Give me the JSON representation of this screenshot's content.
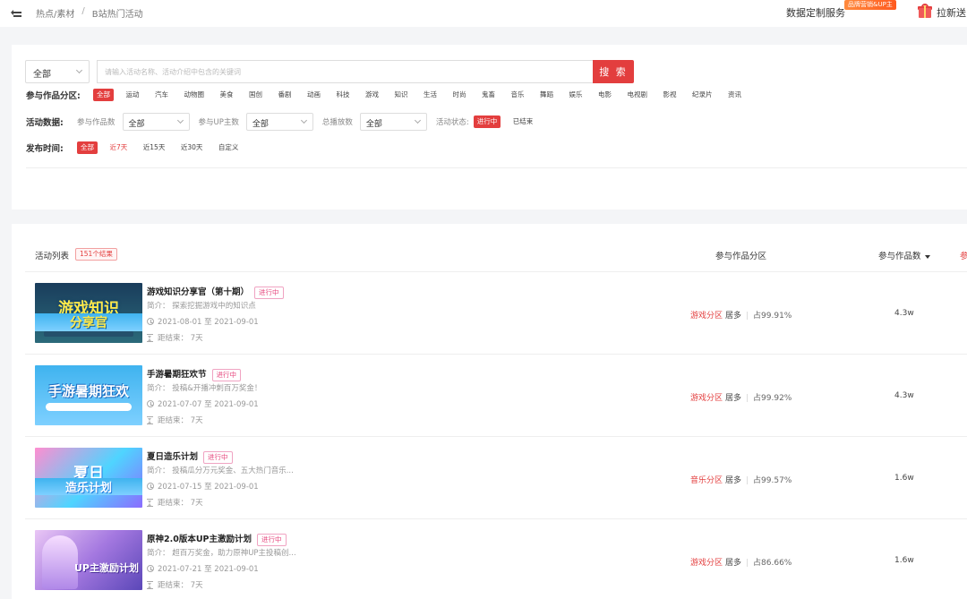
{
  "topbar": {
    "breadcrumb": [
      "热点/素材",
      "/",
      "B站热门活动"
    ],
    "data_service": "数据定制服务",
    "brand_badge": "品牌营销&UP主",
    "invite": "拉新送"
  },
  "filters": {
    "scope_select": "全部",
    "search_placeholder": "请输入活动名称、活动介绍中包含的关键词",
    "search_button": "搜 索",
    "category_label": "参与作品分区:",
    "categories": [
      "全部",
      "运动",
      "汽车",
      "动物圈",
      "美食",
      "国创",
      "番剧",
      "动画",
      "科技",
      "游戏",
      "知识",
      "生活",
      "时尚",
      "鬼畜",
      "音乐",
      "舞蹈",
      "娱乐",
      "电影",
      "电视剧",
      "影视",
      "纪录片",
      "资讯"
    ],
    "active_category": 0,
    "data_label": "活动数据:",
    "works_count_label": "参与作品数",
    "works_count_value": "全部",
    "up_count_label": "参与UP主数",
    "up_count_value": "全部",
    "plays_label": "总播放数",
    "plays_value": "全部",
    "status_label": "活动状态:",
    "status_ongoing": "进行中",
    "status_ended": "已结束",
    "time_label": "发布时间:",
    "time_options": [
      "全部",
      "近7天",
      "近15天",
      "近30天",
      "自定义"
    ]
  },
  "list": {
    "title": "活动列表",
    "count": "151个结果",
    "col_category": "参与作品分区",
    "col_works": "参与作品数",
    "col_more": "参",
    "items": [
      {
        "title": "游戏知识分享官（第十期）",
        "status": "进行中",
        "intro": "简介： 探索挖掘游戏中的知识点",
        "date": "2021-08-01 至 2021-09-01",
        "remaining": "距结束： 7天",
        "zone": "游戏分区",
        "most": "居多",
        "pct": "占99.91%",
        "works": "4.3w",
        "thumb_text": "游戏知识",
        "thumb_text2": "分享官"
      },
      {
        "title": "手游暑期狂欢节",
        "status": "进行中",
        "intro": "简介： 投稿&开播冲刺百万奖金！",
        "date": "2021-07-07 至 2021-09-01",
        "remaining": "距结束： 7天",
        "zone": "游戏分区",
        "most": "居多",
        "pct": "占99.92%",
        "works": "4.3w",
        "thumb_text": "手游暑期狂欢"
      },
      {
        "title": "夏日造乐计划",
        "status": "进行中",
        "intro": "简介： 投稿瓜分万元奖金、五大热门音乐...",
        "date": "2021-07-15 至 2021-09-01",
        "remaining": "距结束： 7天",
        "zone": "音乐分区",
        "most": "居多",
        "pct": "占99.57%",
        "works": "1.6w",
        "thumb_text": "夏日",
        "thumb_text2": "造乐计划"
      },
      {
        "title": "原神2.0版本UP主激励计划",
        "status": "进行中",
        "intro": "简介： 超百万奖金，助力原神UP主投稿创...",
        "date": "2021-07-21 至 2021-09-01",
        "remaining": "距结束： 7天",
        "zone": "游戏分区",
        "most": "居多",
        "pct": "占86.66%",
        "works": "1.6w",
        "thumb_text": "UP主激励计划"
      }
    ]
  },
  "colors": {
    "accent": "#e33e3e",
    "tag": "#e6457c"
  }
}
